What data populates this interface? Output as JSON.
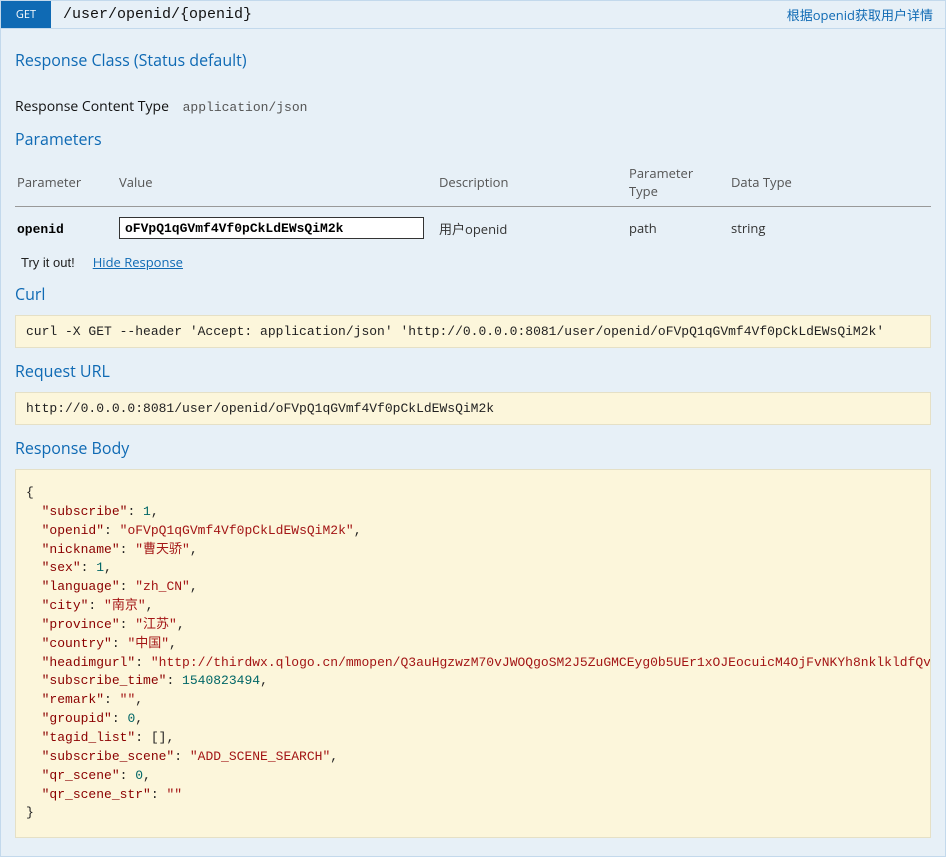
{
  "header": {
    "method": "GET",
    "path": "/user/openid/{openid}",
    "summary": "根据openid获取用户详情"
  },
  "section_titles": {
    "response_class": "Response Class (Status default)",
    "parameters": "Parameters",
    "curl": "Curl",
    "request_url": "Request URL",
    "response_body": "Response Body"
  },
  "response_content_type": {
    "label": "Response Content Type",
    "value": "application/json"
  },
  "param_headers": {
    "parameter": "Parameter",
    "value": "Value",
    "description": "Description",
    "param_type": "Parameter Type",
    "data_type": "Data Type"
  },
  "params": [
    {
      "name": "openid",
      "value": "oFVpQ1qGVmf4Vf0pCkLdEWsQiM2k",
      "description": "用户openid",
      "param_type": "path",
      "data_type": "string"
    }
  ],
  "actions": {
    "try": "Try it out!",
    "hide_response": "Hide Response"
  },
  "curl_command": "curl -X GET --header 'Accept: application/json' 'http://0.0.0.0:8081/user/openid/oFVpQ1qGVmf4Vf0pCkLdEWsQiM2k'",
  "request_url": "http://0.0.0.0:8081/user/openid/oFVpQ1qGVmf4Vf0pCkLdEWsQiM2k",
  "response_body": {
    "subscribe": 1,
    "openid": "oFVpQ1qGVmf4Vf0pCkLdEWsQiM2k",
    "nickname": "曹天骄",
    "sex": 1,
    "language": "zh_CN",
    "city": "南京",
    "province": "江苏",
    "country": "中国",
    "headimgurl": "http://thirdwx.qlogo.cn/mmopen/Q3auHgzwzM70vJWOQgoSM2J5ZuGMCEyg0b5UEr1xOJEocuicM4OjFvNKYh8nklkldfQv",
    "subscribe_time": 1540823494,
    "remark": "",
    "groupid": 0,
    "tagid_list": [],
    "subscribe_scene": "ADD_SCENE_SEARCH",
    "qr_scene": 0,
    "qr_scene_str": ""
  }
}
